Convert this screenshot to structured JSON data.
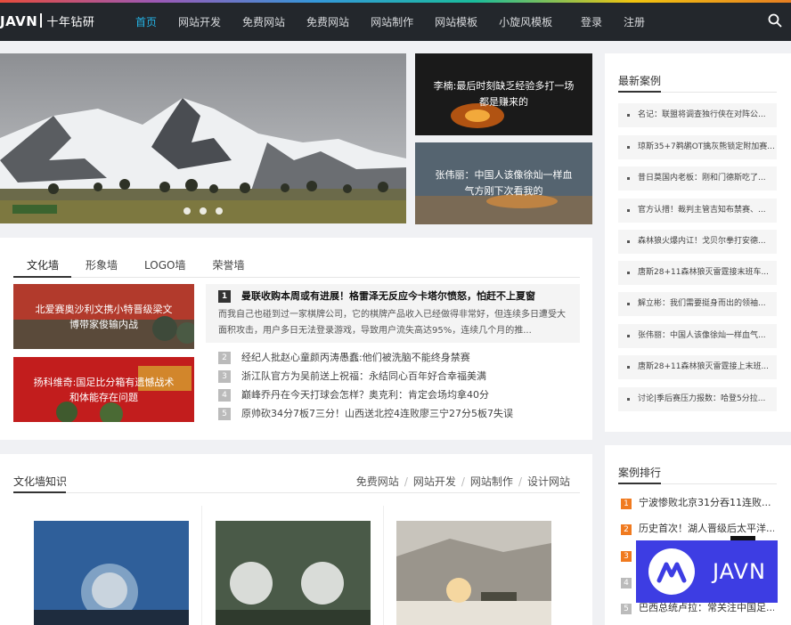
{
  "site": {
    "logo": "JAVN",
    "slogan": "十年钻研",
    "nav": [
      "首页",
      "网站开发",
      "免费网站",
      "免费网站",
      "网站制作",
      "网站模板",
      "小旋风模板"
    ],
    "auth": [
      "登录",
      "注册"
    ]
  },
  "side_cards": [
    "李楠:最后时刻缺乏经验多打一场都是赚来的",
    "张伟丽：中国人该像徐灿一样血气方刚下次看我的"
  ],
  "tabs_panel": {
    "tabs": [
      "文化墙",
      "形象墙",
      "LOGO墙",
      "荣誉墙"
    ],
    "thumbs": [
      "北爱赛奥沙利文携小特晋级梁文博带家俊输内战",
      "扬科维奇:国足比分箱有遗憾战术和体能存在问题"
    ],
    "feature": {
      "num": "1",
      "title": "曼联收购本周或有进展！格雷泽无反应今卡塔尔愤怒，怕赶不上夏窗",
      "summary": "而我自己也碰到过一家棋牌公司，它的棋牌产品收入已经做得非常好，但连续多日遭受大面积攻击，用户多日无法登录游戏，导致用户流失高达95%，连续几个月的推..."
    },
    "news": [
      {
        "num": "2",
        "text": "经纪人批赵心童颜丙涛愚蠢:他们被洗脑不能终身禁赛"
      },
      {
        "num": "3",
        "text": "浙江队官方为吴前送上祝福：永结同心百年好合幸福美满"
      },
      {
        "num": "4",
        "text": "巅峰乔丹在今天打球会怎样？奥克利：肯定会场均拿40分"
      },
      {
        "num": "5",
        "text": "原帅砍34分7板7三分！山西送北控4连败廖三宁27分5板7失误"
      }
    ]
  },
  "knowledge": {
    "title": "文化墙知识",
    "links": [
      "免费网站",
      "网站开发",
      "网站制作",
      "设计网站"
    ],
    "separator": "/"
  },
  "latest_cases": {
    "title": "最新案例",
    "items": [
      "名记：联盟将调查独行侠在对阵公...",
      "琼斯35+7鹈鹕OT擒灰熊锁定附加赛...",
      "昔日莫国内老板：刚和门德斯吃了...",
      "官方认措！裁判主管吉知布禁赛、...",
      "森林狼火爆内讧！戈贝尔拳打安德...",
      "唐斯28+11森林狼灭雷霆接末班车...",
      "解立彬：我们需要挺身而出的领袖...",
      "张伟丽：中国人该像徐灿一样血气...",
      "唐斯28+11森林狼灭雷霆接上末班...",
      "讨论|季后赛压力报数：哈登5分拉..."
    ]
  },
  "ranking": {
    "title": "案例排行",
    "items": [
      {
        "num": "1",
        "text": "宁波惨败北京31分吞11连败..."
      },
      {
        "num": "2",
        "text": "历史首次！湖人晋级后太平洋..."
      },
      {
        "num": "3",
        "text": ""
      },
      {
        "num": "4",
        "text": ""
      },
      {
        "num": "5",
        "text": "巴西总统卢拉：常关注中国足..."
      }
    ]
  },
  "badge": {
    "text": "JAVN"
  },
  "colors": {
    "nav_bg": "#23272c",
    "accent": "#25b3e5",
    "rank_hot": "#f07a1f",
    "badge": "#3d3de3"
  }
}
